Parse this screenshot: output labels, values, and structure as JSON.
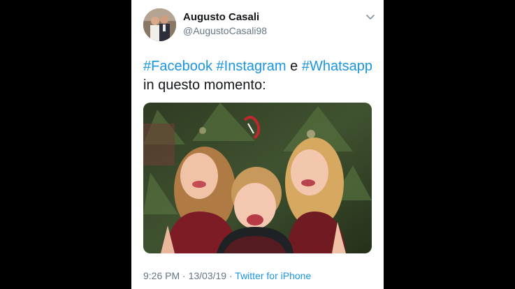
{
  "tweet": {
    "author": {
      "display_name": "Augusto Casali",
      "handle": "@AugustoCasali98"
    },
    "text": {
      "tag1": "#Facebook",
      "tag2": "#Instagram",
      "connector": "e",
      "tag3": "#Whatsapp",
      "line2": "in questo momento:"
    },
    "meta": {
      "time": "9:26 PM",
      "separator": "·",
      "date": "13/03/19",
      "source": "Twitter for iPhone"
    },
    "icons": {
      "menu": "chevron-down-icon"
    }
  },
  "colors": {
    "page_background": "#000000",
    "card_background": "#ffffff",
    "link": "#1b95e0",
    "secondary_text": "#657786",
    "primary_text": "#14171a"
  }
}
